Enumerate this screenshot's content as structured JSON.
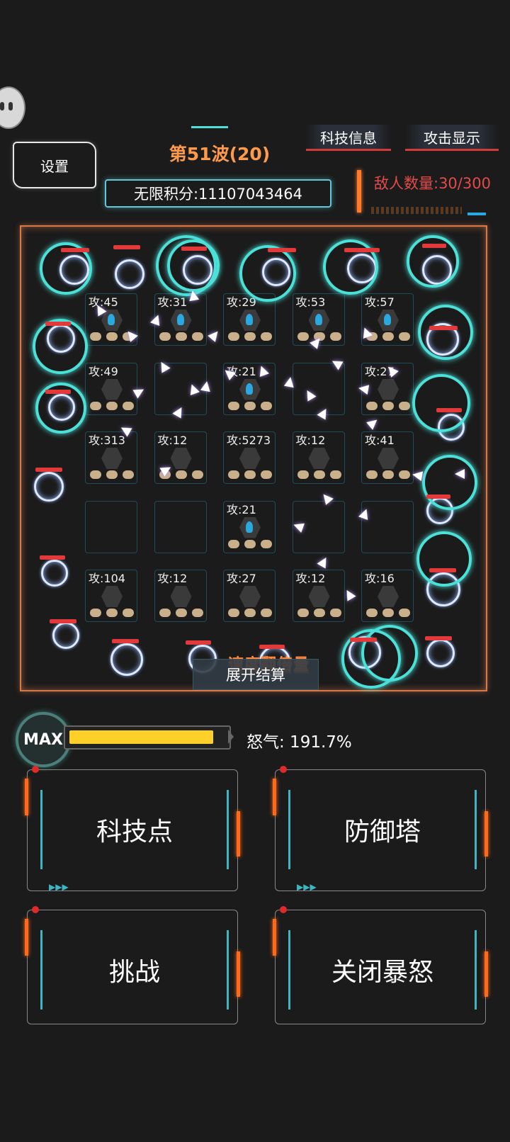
{
  "hud": {
    "settings_label": "设置",
    "wave_label": "第51波(20)",
    "score_label": "无限积分:11107043464",
    "tech_info_label": "科技信息",
    "attack_display_label": "攻击显示",
    "enemy_count_label": "敌人数量:30/300"
  },
  "field": {
    "towers": [
      {
        "label": "攻:45"
      },
      {
        "label": "攻:31"
      },
      {
        "label": "攻:29"
      },
      {
        "label": "攻:53"
      },
      {
        "label": "攻:57"
      },
      {
        "label": "攻:49"
      },
      {
        "label": ""
      },
      {
        "label": "攻:21"
      },
      {
        "label": ""
      },
      {
        "label": "攻:27"
      },
      {
        "label": "攻:313"
      },
      {
        "label": "攻:12"
      },
      {
        "label": "攻:5273"
      },
      {
        "label": "攻:12"
      },
      {
        "label": "攻:41"
      },
      {
        "label": ""
      },
      {
        "label": ""
      },
      {
        "label": "攻:21"
      },
      {
        "label": ""
      },
      {
        "label": ""
      },
      {
        "label": "攻:104"
      },
      {
        "label": "攻:12"
      },
      {
        "label": "攻:27"
      },
      {
        "label": "攻:12"
      },
      {
        "label": "攻:16"
      }
    ],
    "speed_text": "速度翻倍量",
    "expand_label": "展开结算"
  },
  "rage": {
    "max_label": "MAX",
    "rage_label": "怒气: 191.7%",
    "fill_fraction": 0.93,
    "fill_color": "#ffd02a"
  },
  "actions": {
    "tech_points_label": "科技点",
    "defense_tower_label": "防御塔",
    "challenge_label": "挑战",
    "close_rage_label": "关闭暴怒"
  },
  "colors": {
    "accent_cyan": "#4be0d8",
    "accent_orange": "#ff6a1a",
    "wave_orange": "#ff9a4a",
    "enemy_red": "#e34b4b"
  }
}
